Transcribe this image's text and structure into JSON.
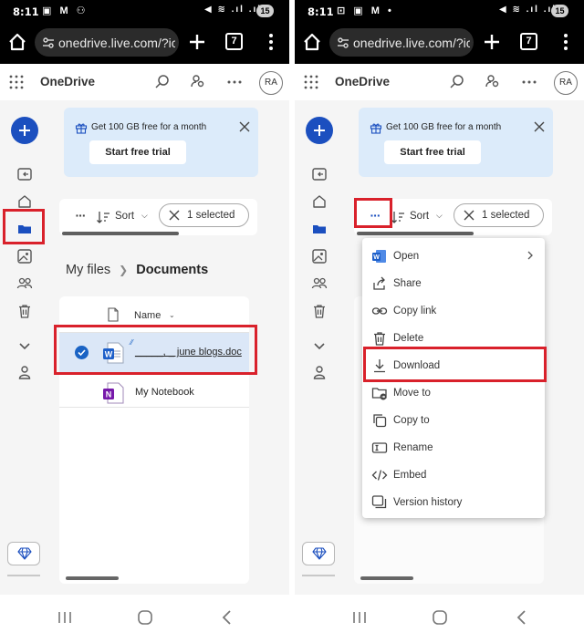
{
  "status": {
    "time": "8:11",
    "battery": "15"
  },
  "browser": {
    "url": "onedrive.live.com/?ic",
    "tab_count": "7"
  },
  "app": {
    "brand": "OneDrive",
    "avatar": "RA"
  },
  "promo": {
    "text": "Get 100 GB free for a month",
    "button": "Start free trial"
  },
  "toolbar": {
    "more": "···",
    "sort": "Sort",
    "selected": "1 selected"
  },
  "breadcrumb": {
    "root": "My files",
    "current": "Documents"
  },
  "list": {
    "column_name": "Name",
    "files": [
      {
        "name": "_____, _ june blogs.doc",
        "selected": true,
        "type": "word"
      },
      {
        "name": "My Notebook",
        "selected": false,
        "type": "onenote"
      }
    ]
  },
  "context_menu": {
    "items": [
      {
        "label": "Open",
        "icon": "word-icon",
        "has_submenu": true
      },
      {
        "label": "Share",
        "icon": "share-icon"
      },
      {
        "label": "Copy link",
        "icon": "link-icon"
      },
      {
        "label": "Delete",
        "icon": "trash-icon"
      },
      {
        "label": "Download",
        "icon": "download-icon",
        "highlighted": true
      },
      {
        "label": "Move to",
        "icon": "move-icon"
      },
      {
        "label": "Copy to",
        "icon": "copy-icon"
      },
      {
        "label": "Rename",
        "icon": "rename-icon"
      },
      {
        "label": "Embed",
        "icon": "embed-icon"
      },
      {
        "label": "Version history",
        "icon": "history-icon"
      }
    ]
  },
  "colors": {
    "accent": "#1b4fbf",
    "highlight": "#d9212b",
    "promo_bg": "#dcebfa",
    "selected_row": "#dbe7f7"
  }
}
